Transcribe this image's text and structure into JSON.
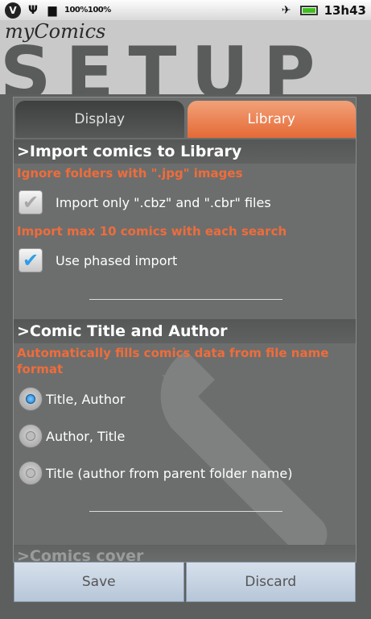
{
  "status_bar": {
    "battery_text": "100%100%",
    "time": "13h43",
    "icons": [
      "v-logo-icon",
      "usb-icon",
      "sd-card-icon",
      "airplane-icon",
      "battery-icon"
    ]
  },
  "header": {
    "app_title": "myComics",
    "banner": "SETUP"
  },
  "tabs": [
    {
      "label": "Display",
      "active": false
    },
    {
      "label": "Library",
      "active": true
    }
  ],
  "import_section": {
    "title": ">Import comics to Library",
    "ignore_text": "Ignore folders with \".jpg\" images",
    "cbz_label": "Import only \".cbz\" and \".cbr\" files",
    "cbz_checked": true,
    "max_text": "Import max 10 comics with each search",
    "phased_label": "Use phased import",
    "phased_checked": true
  },
  "title_section": {
    "title": ">Comic Title and Author",
    "description": "Automatically fills comics data from file name format",
    "options": [
      {
        "label": "Title, Author",
        "selected": true
      },
      {
        "label": "Author, Title",
        "selected": false
      },
      {
        "label": "Title (author from parent folder name)",
        "selected": false
      }
    ]
  },
  "next_section_title": ">Comics cover",
  "buttons": {
    "save": "Save",
    "discard": "Discard"
  },
  "colors": {
    "accent_orange": "#f06c3a",
    "tab_active": "#e56a36",
    "check_blue": "#2e9ee8"
  }
}
